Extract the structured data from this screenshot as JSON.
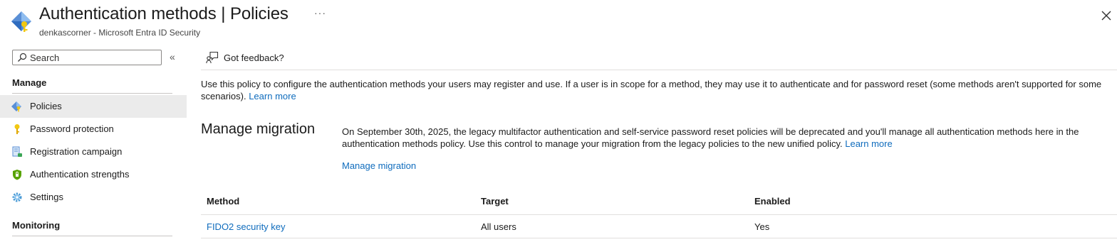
{
  "header": {
    "title_main": "Authentication methods",
    "title_separator": "|",
    "title_section": "Policies",
    "more_label": "···",
    "subtitle": "denkascorner - Microsoft Entra ID Security"
  },
  "sidebar": {
    "search_placeholder": "Search",
    "collapse_label": "«",
    "manage_header": "Manage",
    "monitoring_header": "Monitoring",
    "items": [
      {
        "label": "Policies",
        "icon": "auth-methods-icon",
        "selected": true
      },
      {
        "label": "Password protection",
        "icon": "key-icon",
        "selected": false
      },
      {
        "label": "Registration campaign",
        "icon": "registration-icon",
        "selected": false
      },
      {
        "label": "Authentication strengths",
        "icon": "shield-icon",
        "selected": false
      },
      {
        "label": "Settings",
        "icon": "gear-icon",
        "selected": false
      }
    ]
  },
  "command_bar": {
    "feedback_label": "Got feedback?"
  },
  "content": {
    "intro_text": "Use this policy to configure the authentication methods your users may register and use. If a user is in scope for a method, they may use it to authenticate and for password reset (some methods aren't supported for some scenarios).",
    "intro_link": "Learn more",
    "migration": {
      "title": "Manage migration",
      "description": "On September 30th, 2025, the legacy multifactor authentication and self-service password reset policies will be deprecated and you'll manage all authentication methods here in the authentication methods policy. Use this control to manage your migration from the legacy policies to the new unified policy.",
      "learn_more": "Learn more",
      "action_label": "Manage migration"
    },
    "table": {
      "columns": [
        "Method",
        "Target",
        "Enabled"
      ],
      "rows": [
        {
          "method": "FIDO2 security key",
          "target": "All users",
          "enabled": "Yes"
        }
      ]
    }
  },
  "colors": {
    "link": "#0f6cbd",
    "selected_bg": "#ebebeb",
    "divider": "#e1dfdd"
  }
}
